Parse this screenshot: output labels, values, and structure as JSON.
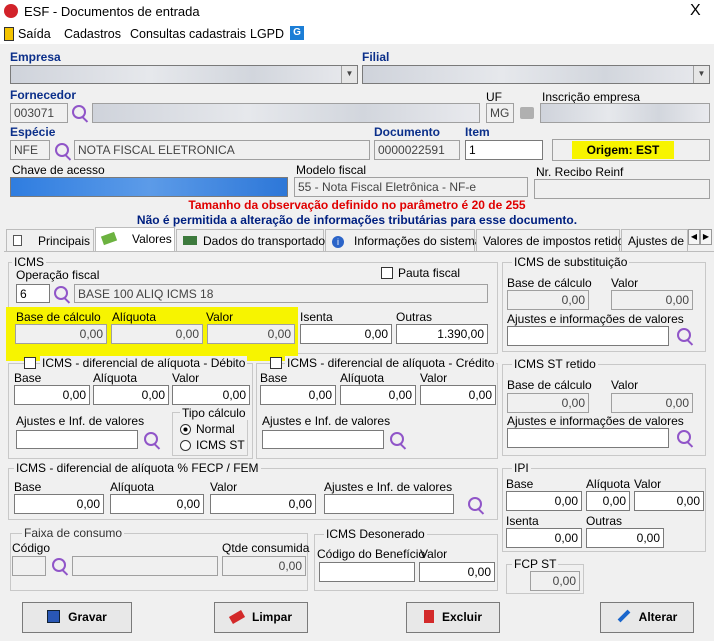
{
  "window": {
    "title": "ESF - Documentos de entrada",
    "close": "X"
  },
  "menu": {
    "saida": "Saída",
    "cadastros": "Cadastros",
    "consultas": "Consultas cadastrais",
    "lgpd": "LGPD"
  },
  "header": {
    "empresa_label": "Empresa",
    "filial_label": "Filial",
    "fornecedor_label": "Fornecedor",
    "fornecedor_code": "003071",
    "uf_label": "UF",
    "uf_value": "MG",
    "inscricao_label": "Inscrição empresa",
    "especie_label": "Espécie",
    "especie_code": "NFE",
    "especie_desc": "NOTA FISCAL ELETRONICA",
    "documento_label": "Documento",
    "documento_value": "0000022591",
    "item_label": "Item",
    "item_value": "1",
    "origem": "Origem: EST",
    "chave_label": "Chave de acesso",
    "modelo_label": "Modelo fiscal",
    "modelo_value": "55 - Nota Fiscal Eletrônica - NF-e",
    "recibo_label": "Nr. Recibo Reinf"
  },
  "messages": {
    "obs": "Tamanho da observação definido no parâmetro é 20 de 255",
    "nao_permitida": "Não é permitida a alteração de informações tributárias para esse documento."
  },
  "tabs": [
    "Principais",
    "Valores",
    "Dados do transportador",
    "Informações do sistema",
    "Valores de impostos retidos",
    "Ajustes de C"
  ],
  "icms": {
    "title": "ICMS",
    "operacao_label": "Operação fiscal",
    "operacao_code": "6",
    "operacao_desc": "BASE 100 ALIQ ICMS 18",
    "pauta_label": "Pauta fiscal",
    "base_label": "Base de cálculo",
    "base": "0,00",
    "aliquota_label": "Alíquota",
    "aliquota": "0,00",
    "valor_label": "Valor",
    "valor": "0,00",
    "isenta_label": "Isenta",
    "isenta": "0,00",
    "outras_label": "Outras",
    "outras": "1.390,00"
  },
  "difal_debito": {
    "title": "ICMS - diferencial de alíquota - Débito",
    "base_label": "Base",
    "base": "0,00",
    "aliquota_label": "Alíquota",
    "aliquota": "0,00",
    "valor_label": "Valor",
    "valor": "0,00",
    "ajustes_label": "Ajustes e Inf. de valores",
    "tipo_label": "Tipo cálculo",
    "normal": "Normal",
    "icms_st": "ICMS ST"
  },
  "difal_credito": {
    "title": "ICMS - diferencial de alíquota - Crédito",
    "base_label": "Base",
    "base": "0,00",
    "aliquota_label": "Alíquota",
    "aliquota": "0,00",
    "valor_label": "Valor",
    "valor": "0,00",
    "ajustes_label": "Ajustes e Inf. de valores"
  },
  "fecp": {
    "title": "ICMS - diferencial de alíquota % FECP / FEM",
    "base_label": "Base",
    "base": "0,00",
    "aliquota_label": "Alíquota",
    "aliquota": "0,00",
    "valor_label": "Valor",
    "valor": "0,00",
    "ajustes_label": "Ajustes e Inf. de valores"
  },
  "faixa": {
    "title": "Faixa de consumo",
    "codigo_label": "Código",
    "qtde_label": "Qtde consumida",
    "qtde": "0,00"
  },
  "desonerado": {
    "title": "ICMS Desonerado",
    "codigo_label": "Código do Benefício",
    "valor_label": "Valor",
    "valor": "0,00"
  },
  "st": {
    "title": "ICMS de substituição",
    "base_label": "Base de cálculo",
    "base": "0,00",
    "valor_label": "Valor",
    "valor": "0,00",
    "ajustes_label": "Ajustes e informações de valores"
  },
  "st_retido": {
    "title": "ICMS ST retido",
    "base_label": "Base de cálculo",
    "base": "0,00",
    "valor_label": "Valor",
    "valor": "0,00",
    "ajustes_label": "Ajustes e informações de valores"
  },
  "ipi": {
    "title": "IPI",
    "base_label": "Base",
    "base": "0,00",
    "aliquota_label": "Alíquota",
    "aliquota": "0,00",
    "valor_label": "Valor",
    "valor": "0,00",
    "isenta_label": "Isenta",
    "isenta": "0,00",
    "outras_label": "Outras",
    "outras": "0,00"
  },
  "fcp_st": {
    "title": "FCP ST",
    "valor": "0,00"
  },
  "buttons": {
    "gravar": "Gravar",
    "limpar": "Limpar",
    "excluir": "Excluir",
    "alterar": "Alterar"
  }
}
